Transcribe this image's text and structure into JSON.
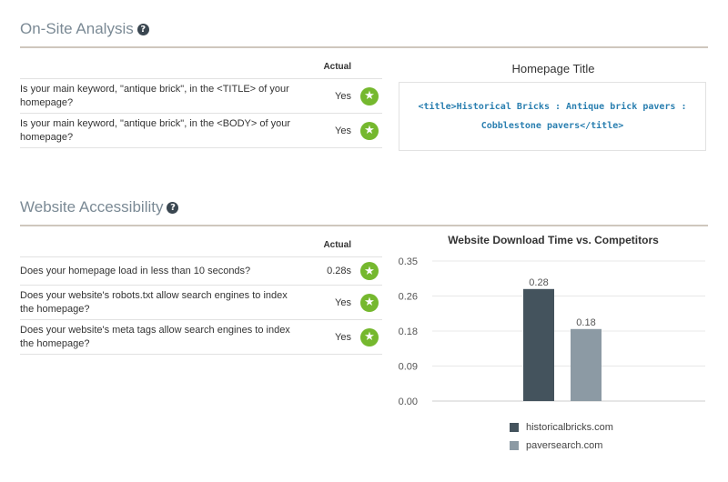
{
  "onsite": {
    "title": "On-Site Analysis",
    "help": "?",
    "actual_label": "Actual",
    "rows": [
      {
        "question": "Is your main keyword, \"antique brick\", in the <TITLE> of your homepage?",
        "value": "Yes"
      },
      {
        "question": "Is your main keyword, \"antique brick\", in the <BODY> of your homepage?",
        "value": "Yes"
      }
    ],
    "homepage_title_label": "Homepage Title",
    "homepage_title_code": "<title>Historical Bricks : Antique brick pavers : Cobblestone pavers</title>"
  },
  "accessibility": {
    "title": "Website Accessibility",
    "help": "?",
    "actual_label": "Actual",
    "rows": [
      {
        "question": "Does your homepage load in less than 10 seconds?",
        "value": "0.28s"
      },
      {
        "question": "Does your website's robots.txt allow search engines to index the homepage?",
        "value": "Yes"
      },
      {
        "question": "Does your website's meta tags allow search engines to index the homepage?",
        "value": "Yes"
      }
    ]
  },
  "chart_data": {
    "type": "bar",
    "title": "Website Download Time vs. Competitors",
    "categories": [
      "historicalbricks.com",
      "paversearch.com"
    ],
    "values": [
      0.28,
      0.18
    ],
    "value_labels": [
      "0.28",
      "0.18"
    ],
    "colors": [
      "#44535d",
      "#8c9aa4"
    ],
    "ylim": [
      0,
      0.35
    ],
    "yticks": [
      "0.00",
      "0.09",
      "0.18",
      "0.26",
      "0.35"
    ],
    "ytick_values": [
      0,
      0.0875,
      0.175,
      0.2625,
      0.35
    ],
    "legend_position": "bottom",
    "grid": true
  },
  "icons": {
    "star": "★",
    "help": "question-mark"
  }
}
